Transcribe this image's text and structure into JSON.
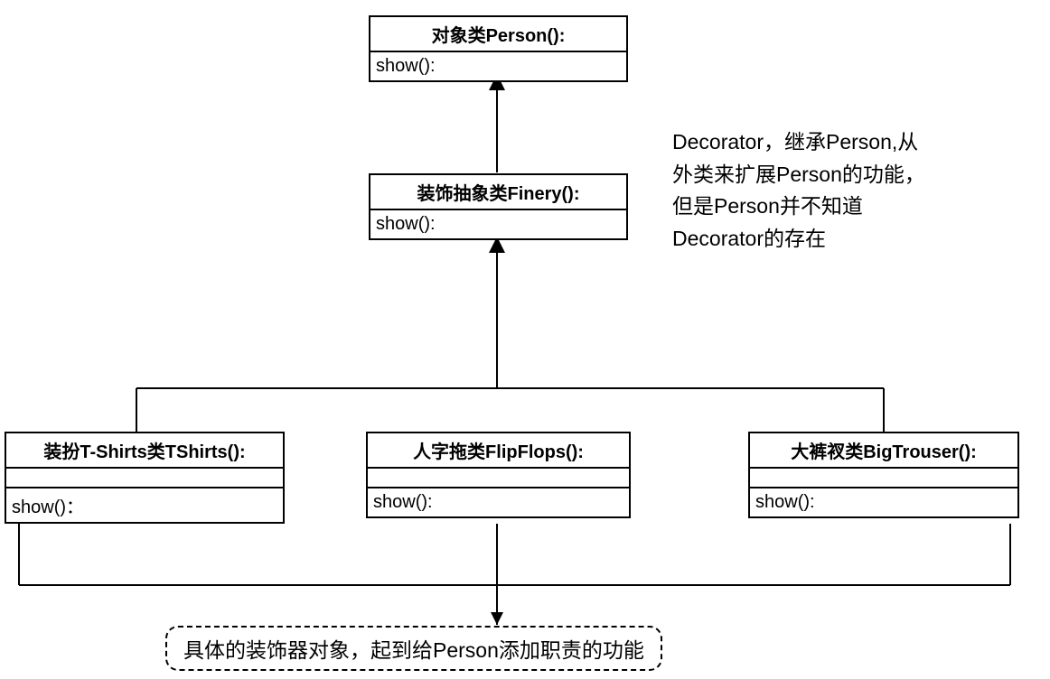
{
  "classes": {
    "person": {
      "title": "对象类Person():",
      "method": "show():"
    },
    "finery": {
      "title": "装饰抽象类Finery():",
      "method": "show():"
    },
    "tshirts": {
      "title": "装扮T-Shirts类TShirts():",
      "method": "show()："
    },
    "flipflops": {
      "title": "人字拖类FlipFlops():",
      "method": "show():"
    },
    "bigtrouser": {
      "title": "大裤衩类BigTrouser():",
      "method": "show():"
    }
  },
  "annotations": {
    "finery_note": "Decorator，继承Person,从外类来扩展Person的功能，但是Person并不知道Decorator的存在",
    "concrete_note": "具体的装饰器对象，起到给Person添加职责的功能"
  }
}
